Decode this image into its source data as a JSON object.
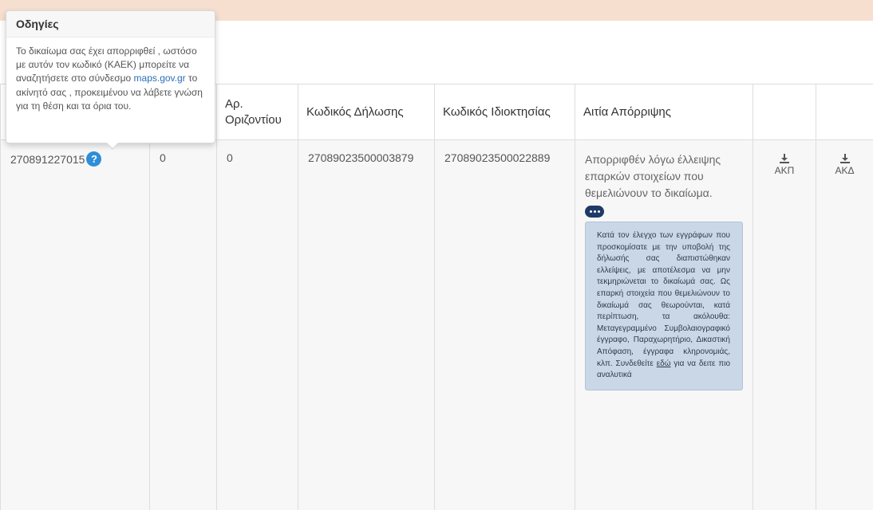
{
  "tooltip": {
    "title": "Οδηγίες",
    "body_before": "Το δικαίωμα σας έχει απορριφθεί , ωστόσο με αυτόν τον κωδικό (ΚΑΕΚ) μπορείτε να αναζητήσετε στο σύνδεσμο ",
    "link": "maps.gov.gr",
    "body_after": " το ακίνητό σας , προκειμένου να λάβετε γνώση για τη θέση και τα όρια του."
  },
  "table": {
    "headers": [
      "",
      "",
      "Αρ. Οριζοντίου",
      "Κωδικός Δήλωσης",
      "Κωδικός Ιδιοκτησίας",
      "Αιτία Απόρριψης",
      "",
      ""
    ],
    "row": {
      "kaek": "270891227015",
      "col2": "0",
      "horizontal": "0",
      "declaration_code": "27089023500003879",
      "property_code": "27089023500022889",
      "reason": "Απορριφθέν λόγω έλλειψης επαρκών στοιχείων που θεμελιώνουν το δικαίωμα.",
      "detail_before": "Κατά τον έλεγχο των εγγράφων που προσκομίσατε με την υποβολή της δήλωσής σας διαπιστώθηκαν ελλείψεις, με αποτέλεσμα να μην τεκμηριώνεται το δικαίωμά σας. Ως επαρκή στοιχεία που θεμελιώνουν το δικαίωμά σας θεωρούνται, κατά περίπτωση, τα ακόλουθα: Μεταγεγραμμένο Συμβολαιογραφικό έγγραφο, Παραχωρητήριο, Δικαστική Απόφαση, έγγραφα κληρονομιάς, κλπ. Συνδεθείτε ",
      "detail_link": "εδώ",
      "detail_after": " για να δειτε πιο αναλυτικά",
      "download_1": "ΑΚΠ",
      "download_2": "ΑΚΔ"
    }
  },
  "icons": {
    "help": "question-circle-icon",
    "more": "ellipsis-icon",
    "download": "download-icon"
  },
  "colors": {
    "banner": "#f7dfd0",
    "help_icon": "#2e8ed8",
    "more_button": "#1f3a68",
    "detail_box": "#c9d7e7",
    "link": "#2a6eb5"
  }
}
